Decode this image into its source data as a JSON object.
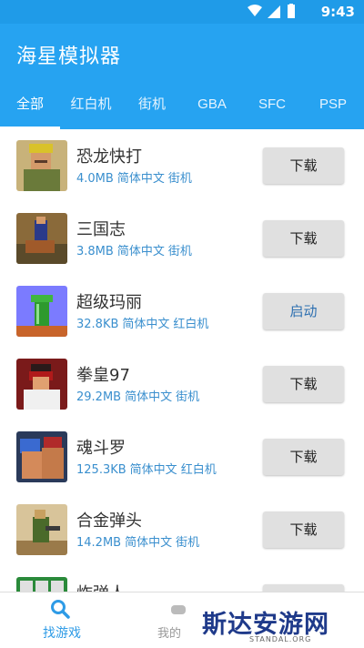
{
  "status": {
    "time": "9:43"
  },
  "app": {
    "title": "海星模拟器"
  },
  "tabs": [
    {
      "label": "全部"
    },
    {
      "label": "红白机"
    },
    {
      "label": "街机"
    },
    {
      "label": "GBA"
    },
    {
      "label": "SFC"
    },
    {
      "label": "PSP"
    }
  ],
  "games": [
    {
      "title": "恐龙快打",
      "size": "4.0MB",
      "lang": "简体中文",
      "platform": "街机",
      "action": "下载"
    },
    {
      "title": "三国志",
      "size": "3.8MB",
      "lang": "简体中文",
      "platform": "街机",
      "action": "下载"
    },
    {
      "title": "超级玛丽",
      "size": "32.8KB",
      "lang": "简体中文",
      "platform": "红白机",
      "action": "启动"
    },
    {
      "title": "拳皇97",
      "size": "29.2MB",
      "lang": "简体中文",
      "platform": "街机",
      "action": "下载"
    },
    {
      "title": "魂斗罗",
      "size": "125.3KB",
      "lang": "简体中文",
      "platform": "红白机",
      "action": "下载"
    },
    {
      "title": "合金弹头",
      "size": "14.2MB",
      "lang": "简体中文",
      "platform": "街机",
      "action": "下载"
    },
    {
      "title": "炸弹人",
      "size": "",
      "lang": "",
      "platform": "",
      "action": "下载"
    }
  ],
  "bottom_nav": {
    "find_label": "找游戏",
    "mine_label": "我的"
  },
  "watermark": {
    "text": "斯达安游网",
    "sub": "STANDAL.ORG"
  },
  "colors": {
    "accent": "#26a3f1",
    "meta": "#3a8fce"
  }
}
